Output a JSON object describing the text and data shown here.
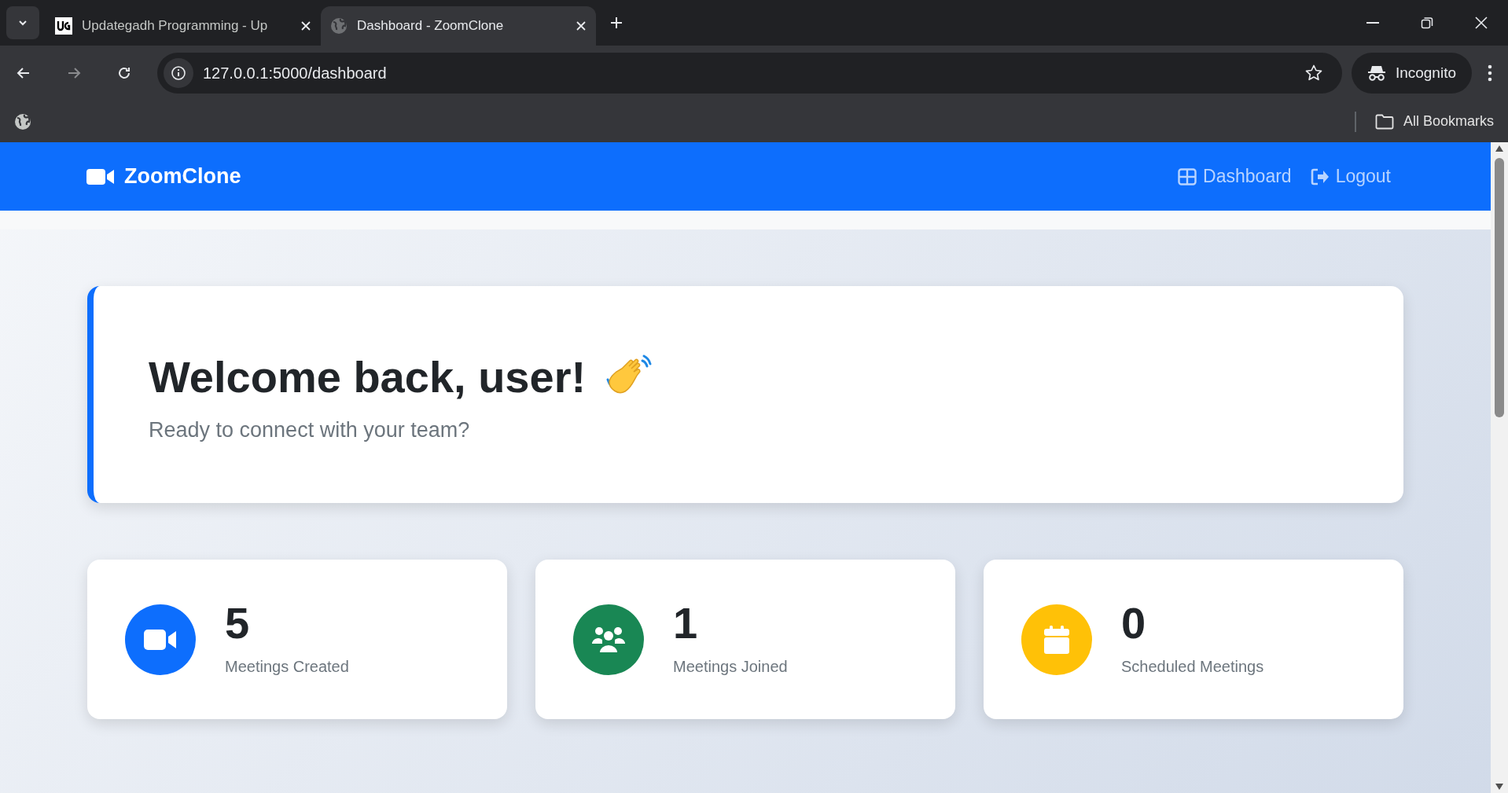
{
  "browser": {
    "tabs": [
      {
        "title": "Updategadh Programming - Up",
        "kind": "logo",
        "selected": false
      },
      {
        "title": "Dashboard - ZoomClone",
        "kind": "globe",
        "selected": true
      }
    ],
    "address": "127.0.0.1:5000/dashboard",
    "profile": "Incognito",
    "bookmarks_label": "All Bookmarks"
  },
  "navbar": {
    "brand": "ZoomClone",
    "links": [
      {
        "label": "Dashboard",
        "kind": "grid"
      },
      {
        "label": "Logout",
        "kind": "logout"
      }
    ]
  },
  "welcome": {
    "title": "Welcome back, user!",
    "subtitle": "Ready to connect with your team?"
  },
  "stats": [
    {
      "value": "5",
      "label": "Meetings Created",
      "kind": "video",
      "color": "#0d6efd"
    },
    {
      "value": "1",
      "label": "Meetings Joined",
      "kind": "people",
      "color": "#198754"
    },
    {
      "value": "0",
      "label": "Scheduled Meetings",
      "kind": "calendar",
      "color": "#ffc107"
    }
  ]
}
